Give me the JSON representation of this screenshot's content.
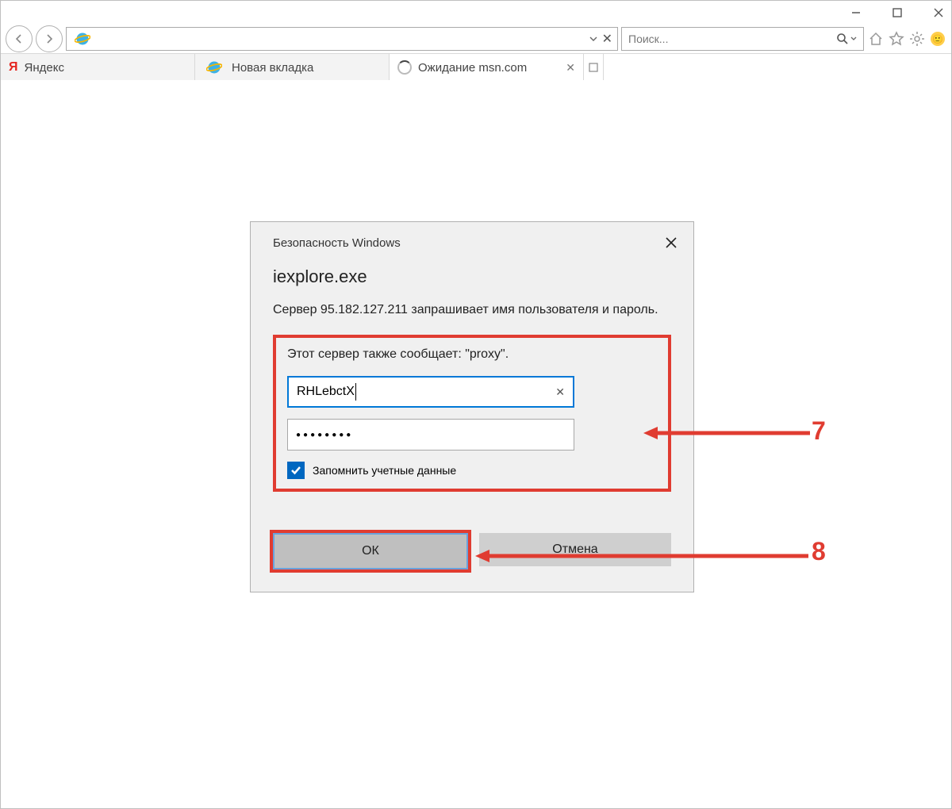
{
  "window_controls": {
    "minimize": "–",
    "maximize": "☐",
    "close": "✕"
  },
  "toolbar": {
    "url_value": "",
    "search_placeholder": "Поиск..."
  },
  "tabs": [
    {
      "label": "Яндекс"
    },
    {
      "label": "Новая вкладка"
    },
    {
      "label": "Ожидание msn.com"
    }
  ],
  "dialog": {
    "header": "Безопасность Windows",
    "app": "iexplore.exe",
    "message": "Сервер 95.182.127.211 запрашивает имя пользователя и пароль.",
    "realm": "Этот сервер также сообщает: \"proxy\".",
    "username": "RHLebctX",
    "password_mask": "●●●●●●●●",
    "remember": "Запомнить учетные данные",
    "ok": "ОК",
    "cancel": "Отмена"
  },
  "annotations": {
    "a7": "7",
    "a8": "8"
  }
}
